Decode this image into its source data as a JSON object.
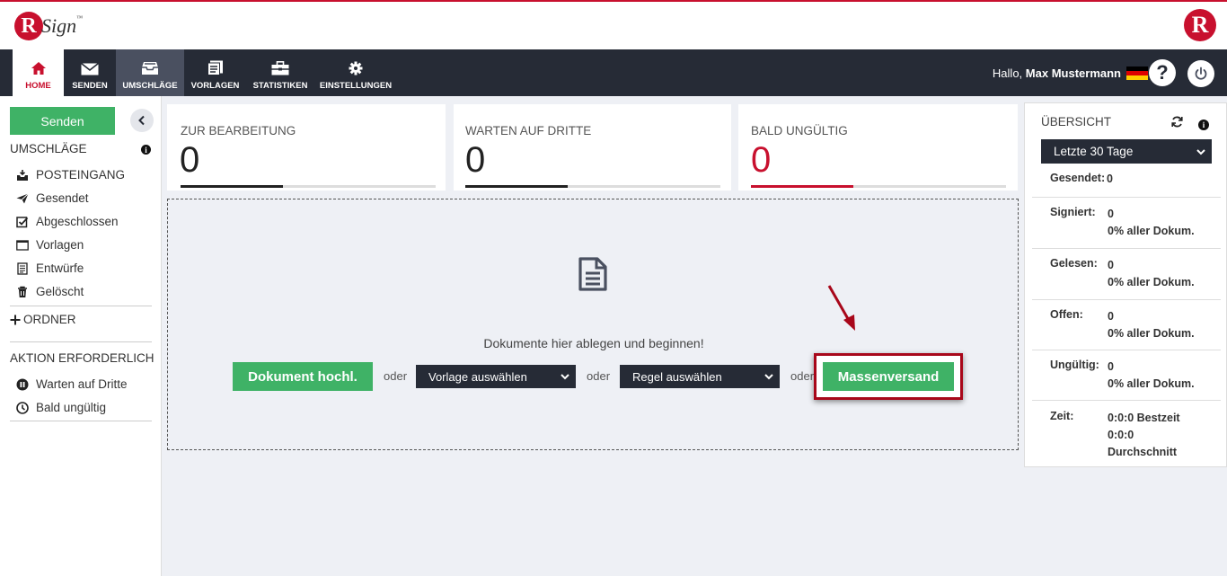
{
  "brand": {
    "logo_letter": "R",
    "logo_text": "Sign",
    "logo_tm": "™",
    "right_logo_letter": "R"
  },
  "nav": {
    "items": [
      {
        "label": "HOME",
        "icon": "home-icon"
      },
      {
        "label": "SENDEN",
        "icon": "envelope-icon"
      },
      {
        "label": "UMSCHLÄGE",
        "icon": "inbox-icon"
      },
      {
        "label": "VORLAGEN",
        "icon": "template-icon"
      },
      {
        "label": "STATISTIKEN",
        "icon": "briefcase-icon"
      },
      {
        "label": "EINSTELLUNGEN",
        "icon": "gear-icon"
      }
    ],
    "greeting_prefix": "Hallo,",
    "user_name": "Max Mustermann",
    "help_label": "?"
  },
  "sidebar": {
    "send_label": "Senden",
    "envelopes_title": "UMSCHLÄGE",
    "items": [
      {
        "label": "POSTEINGANG",
        "icon": "inbox-tray-icon"
      },
      {
        "label": "Gesendet",
        "icon": "paper-plane-icon"
      },
      {
        "label": "Abgeschlossen",
        "icon": "checkbox-icon"
      },
      {
        "label": "Vorlagen",
        "icon": "window-icon"
      },
      {
        "label": "Entwürfe",
        "icon": "draft-icon"
      },
      {
        "label": "Gelöscht",
        "icon": "trash-icon"
      }
    ],
    "folder_label": "ORDNER",
    "action_title": "AKTION ERFORDERLICH",
    "action_items": [
      {
        "label": "Warten auf Dritte",
        "icon": "pause-icon"
      },
      {
        "label": "Bald ungültig",
        "icon": "clock-icon"
      }
    ]
  },
  "cards": [
    {
      "title": "ZUR BEARBEITUNG",
      "value": "0",
      "progress": 0.4
    },
    {
      "title": "WARTEN AUF DRITTE",
      "value": "0",
      "progress": 0.4
    },
    {
      "title": "BALD UNGÜLTIG",
      "value": "0",
      "progress": 0.4
    }
  ],
  "dropzone": {
    "text": "Dokumente hier ablegen und beginnen!",
    "upload_label": "Dokument hochl.",
    "or": "oder",
    "template_select": "Vorlage auswählen",
    "rule_select": "Regel auswählen",
    "mass_label": "Massenversand"
  },
  "overview": {
    "title": "ÜBERSICHT",
    "period": "Letzte 30 Tage",
    "rows": [
      {
        "label": "Gesendet:",
        "lines": [
          "0"
        ]
      },
      {
        "label": "Signiert:",
        "lines": [
          "0",
          "0% aller Dokum."
        ]
      },
      {
        "label": "Gelesen:",
        "lines": [
          "0",
          "0% aller Dokum."
        ]
      },
      {
        "label": "Offen:",
        "lines": [
          "0",
          "0% aller Dokum."
        ]
      },
      {
        "label": "Ungültig:",
        "lines": [
          "0",
          "0% aller Dokum."
        ]
      },
      {
        "label": "Zeit:",
        "lines": [
          "0:0:0 Bestzeit",
          "0:0:0",
          "Durchschnitt"
        ]
      }
    ]
  },
  "colors": {
    "accent_red": "#c8102e",
    "green": "#3fb266",
    "dark": "#262b36",
    "highlight": "#a8071a"
  }
}
